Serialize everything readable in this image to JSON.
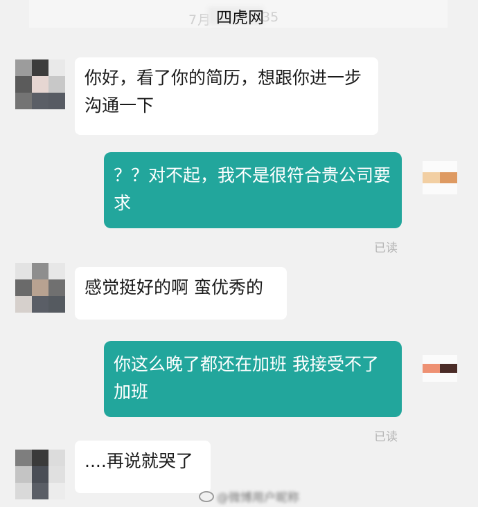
{
  "header": {
    "timestamp_start": "7月",
    "timestamp_end": "35",
    "watermark": "四虎网"
  },
  "messages": [
    {
      "side": "left",
      "text": "你好，看了你的简历，想跟你进一步沟通一下"
    },
    {
      "side": "right",
      "text": "？？对不起，我不是很符合贵公司要求",
      "status": "已读"
    },
    {
      "side": "left",
      "text": "感觉挺好的啊 蛮优秀的"
    },
    {
      "side": "right",
      "text": "你这么晚了都还在加班 我接受不了加班",
      "status": "已读"
    },
    {
      "side": "left",
      "text": "....再说就哭了"
    }
  ],
  "footer": {
    "weibo_handle": "@微博用户昵称"
  },
  "colors": {
    "background": "#f1f1f1",
    "outgoing_bubble": "#22a69c",
    "incoming_bubble": "#ffffff",
    "status_text": "#b5b5b5"
  },
  "icons": {
    "avatars": "pixelated-avatar-icon",
    "weibo": "weibo-icon"
  }
}
